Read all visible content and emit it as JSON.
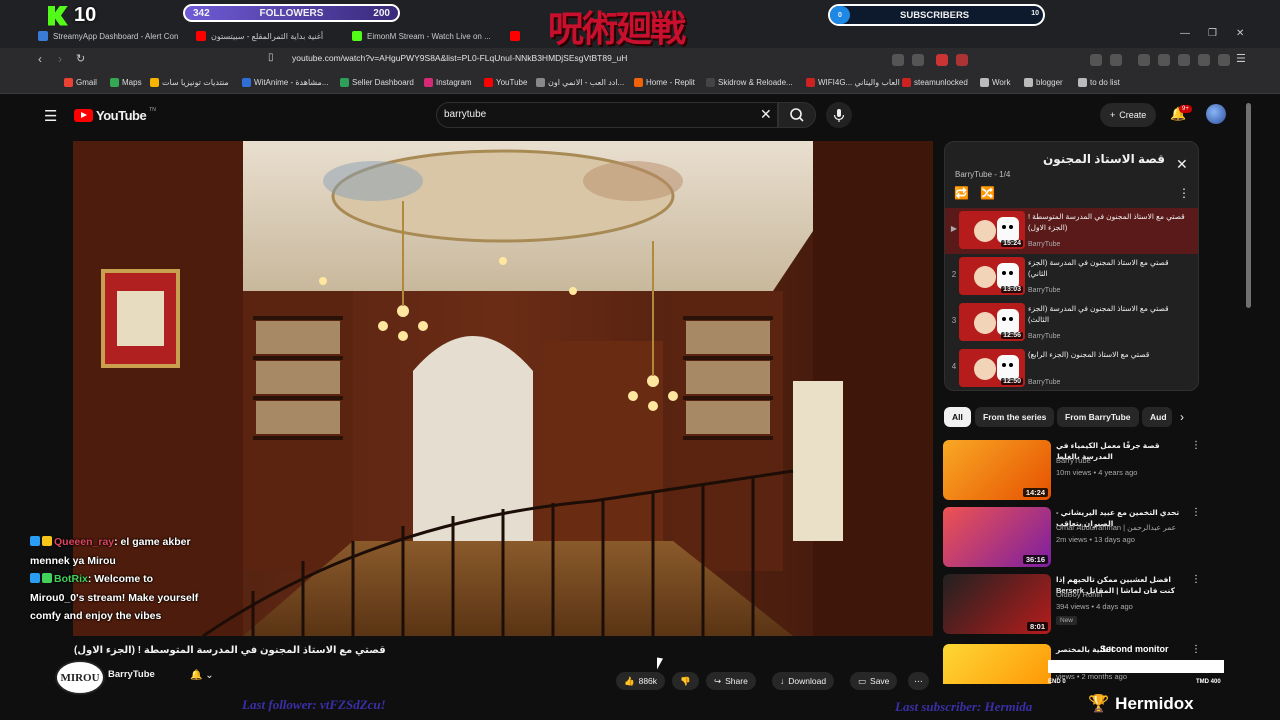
{
  "browser": {
    "tabs": [
      {
        "label": "StreamyApp Dashboard - Alert Conf...",
        "color": "#3a7bd5"
      },
      {
        "label": "أغنية بداية الثمرالمقلع - سبيتستون",
        "color": "#ff0000"
      },
      {
        "label": "EimonM Stream - Watch Live on ...",
        "color": "#53fc18"
      },
      {
        "label": "",
        "color": "#ff0000"
      }
    ],
    "url": "youtube.com/watch?v=AHguPWY9S8A&list=PL0-FLqUnuI-NNkB3HMDjSEsgVtBT89_uH",
    "bookmarks": [
      {
        "label": "Gmail",
        "color": "#ea4335"
      },
      {
        "label": "Maps",
        "color": "#34a853"
      },
      {
        "label": "منتديات تونيزيا سات",
        "color": "#f4b400"
      },
      {
        "label": "WitAnime - مشاهدة...",
        "color": "#2f6fd6"
      },
      {
        "label": "Seller Dashboard",
        "color": "#2e9e5b"
      },
      {
        "label": "Instagram",
        "color": "#d62976"
      },
      {
        "label": "YouTube",
        "color": "#ff0000"
      },
      {
        "label": "ادد العب - الانمي اون...",
        "color": "#888888"
      },
      {
        "label": "Home - Replit",
        "color": "#f26207"
      },
      {
        "label": "Skidrow & Reloade...",
        "color": "#444444"
      },
      {
        "label": "WIFI4G... العاب واليتاني",
        "color": "#cc2222"
      },
      {
        "label": "steamunlocked",
        "color": "#cc2222"
      },
      {
        "label": "Work",
        "color": "#bbbbbb"
      },
      {
        "label": "blogger",
        "color": "#bbbbbb"
      },
      {
        "label": "to do list",
        "color": "#bbbbbb"
      }
    ]
  },
  "youtube": {
    "logo_text": "YouTube",
    "logo_sup": "TN",
    "search_value": "barrytube",
    "create_label": "Create",
    "notif_badge": "9+",
    "video_title": "قصتي مع الاستاذ المجنون في المدرسة المتوسطة ! (الجزء الاول)",
    "channel_name": "BarryTube",
    "likes": "886k",
    "share_label": "Share",
    "download_label": "Download",
    "save_label": "Save",
    "playlist": {
      "title": "قصة الاستاذ المجنون",
      "subtitle": "BarryTube - 1/4",
      "items": [
        {
          "index": "▶",
          "title": "قصتي مع الاستاذ المجنون في المدرسة المتوسطة ! (الجزء الاول)",
          "duration": "15:24",
          "channel": "BarryTube"
        },
        {
          "index": "2",
          "title": "قصتي مع الاستاذ المجنون في المدرسة (الجزء الثاني)",
          "duration": "13:03",
          "channel": "BarryTube"
        },
        {
          "index": "3",
          "title": "قصتي مع الاستاذ المجنون في المدرسة (الجزء الثالث)",
          "duration": "12:56",
          "channel": "BarryTube"
        },
        {
          "index": "4",
          "title": "قصتي مع الاستاذ المجنون (الجزء الرابع)",
          "duration": "12:50",
          "channel": "BarryTube"
        }
      ]
    },
    "chips": [
      "All",
      "From the series",
      "From BarryTube",
      "Aud"
    ],
    "recommendations": [
      {
        "title": "قصة جرفًا معمل الكيمياء في المدرسة بالغلط",
        "channel": "BarryTube",
        "meta": "10m views • 4 years ago",
        "duration": "14:24",
        "tag": ""
      },
      {
        "title": "تحدي التخمين مع عبيد اليريشاني - الصبران يتعاقب",
        "channel": "Omar Abdulrahman | عمر عبدالرحمن",
        "meta": "2m views • 13 days ago",
        "duration": "36:16",
        "tag": ""
      },
      {
        "title": "افضل لعشبين ممكن تالحيهم إذا كنت فان لماشا | المقاتل Berserk",
        "channel": "OldBoy Ronin",
        "meta": "394 views • 4 days ago",
        "duration": "8:01",
        "tag": "New"
      },
      {
        "title": "الثانية بالمختصر",
        "channel": "",
        "meta": "views • 2 months ago",
        "duration": "",
        "tag": ""
      }
    ]
  },
  "overlay": {
    "kick_count": "10",
    "followers_label": "FOLLOWERS",
    "followers_left": "342",
    "followers_right": "200",
    "subscribers_label": "SUBSCRIBERS",
    "subscribers_left": "0",
    "subscribers_right": "10",
    "banner_text": "呪術廻戦",
    "chat": [
      {
        "user": "Queeen_ray",
        "text": ": el game akber mennek ya Mirou"
      },
      {
        "user": "BotRix",
        "text": ": Welcome to Mirou0_0's stream! Make yourself comfy and enjoy the vibes"
      }
    ],
    "last_follower": "Last follower: vtFZSdZcu!",
    "last_subscriber": "Last subscriber: Hermida",
    "brand": "Hermidox",
    "mirou_logo": "MIROU",
    "second_monitor": "Second monitor",
    "end_left": "END 0",
    "end_right": "TMD 400"
  },
  "colors": {
    "yt_red": "#ff0000",
    "bg": "#0f0f0f",
    "kick_green": "#53fc18"
  }
}
